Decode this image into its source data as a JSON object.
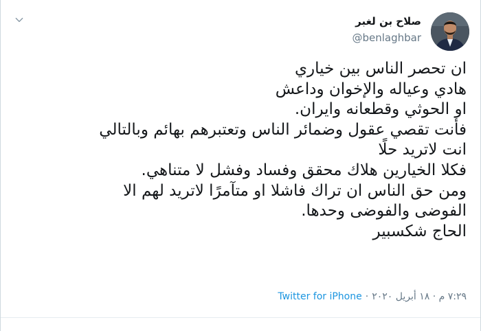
{
  "author": {
    "display_name": "صلاح بن لغبر",
    "handle": "@benlaghbar"
  },
  "icons": {
    "more": "chevron-down-icon",
    "avatar": "user-photo"
  },
  "tweet": {
    "lines": [
      "ان تحصر الناس بين خياري",
      "هادي وعياله والإخوان وداعش",
      "او الحوثي وقطعانه وايران.",
      "فأنت تقصي عقول وضمائر الناس وتعتبرهم بهائم وبالتالي",
      "انت لاتريد حلًا",
      "فكلا الخيارين هلاك محقق وفساد وفشل لا متناهي.",
      "ومن حق الناس ان تراك فاشلا او متآمرًا لاتريد لهم الا",
      "الفوضى والفوضى وحدها.",
      "الحاج شكسبير"
    ]
  },
  "meta": {
    "source": "Twitter for iPhone",
    "separator": "·",
    "timestamp": "٧:٢٩ م · ١٨ أبريل ٢٠٢٠"
  },
  "colors": {
    "text": "#14171a",
    "secondary": "#657786",
    "link": "#1b95e0",
    "border": "#cfd9de"
  }
}
